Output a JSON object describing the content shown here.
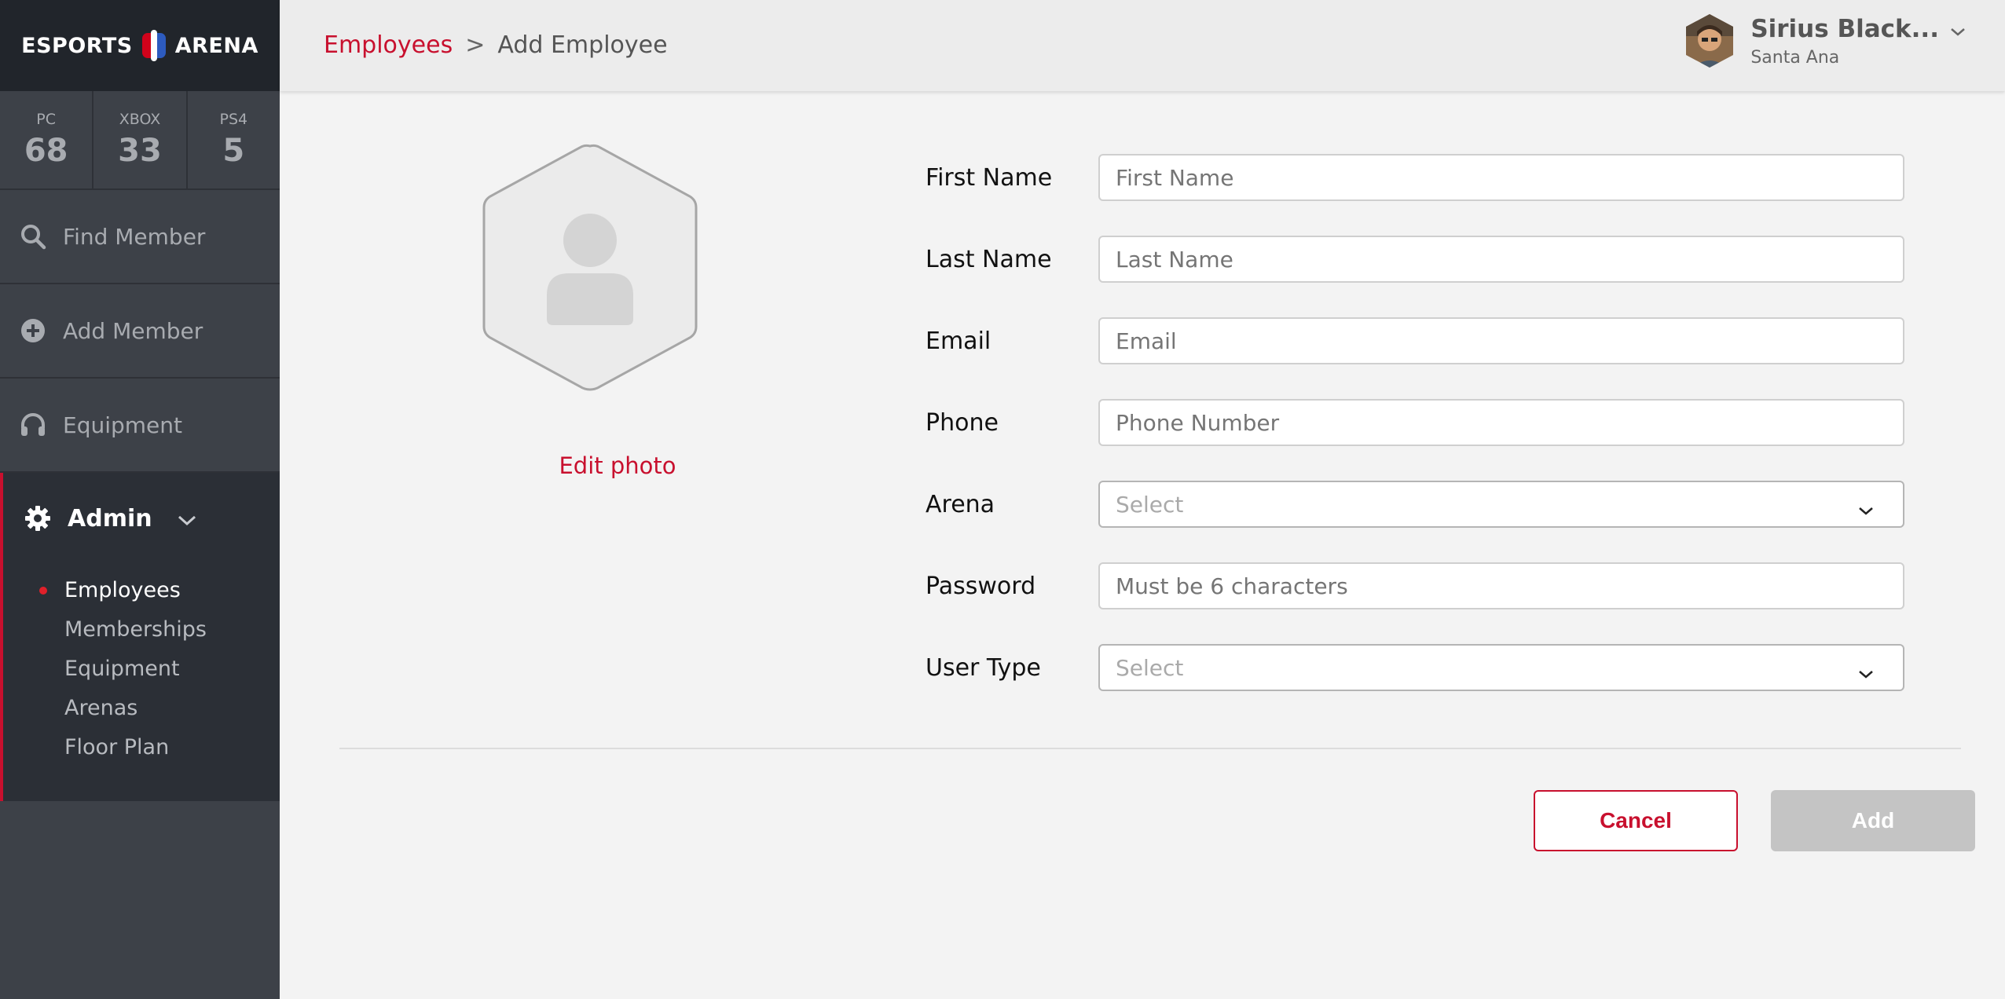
{
  "brand": {
    "left": "ESPORTS",
    "right": "ARENA"
  },
  "stats": [
    {
      "label": "PC",
      "value": "68"
    },
    {
      "label": "XBOX",
      "value": "33"
    },
    {
      "label": "PS4",
      "value": "5"
    }
  ],
  "nav": {
    "find_member": "Find Member",
    "add_member": "Add Member",
    "equipment": "Equipment",
    "admin": "Admin",
    "admin_items": [
      "Employees",
      "Memberships",
      "Equipment",
      "Arenas",
      "Floor Plan"
    ]
  },
  "breadcrumb": {
    "parent": "Employees",
    "separator": ">",
    "current": "Add Employee"
  },
  "user": {
    "name": "Sirius Black...",
    "location": "Santa Ana"
  },
  "photo": {
    "edit_label": "Edit photo"
  },
  "form": {
    "first_name": {
      "label": "First Name",
      "placeholder": "First Name"
    },
    "last_name": {
      "label": "Last Name",
      "placeholder": "Last Name"
    },
    "email": {
      "label": "Email",
      "placeholder": "Email"
    },
    "phone": {
      "label": "Phone",
      "placeholder": "Phone Number"
    },
    "arena": {
      "label": "Arena",
      "value": "Select"
    },
    "password": {
      "label": "Password",
      "placeholder": "Must be 6 characters"
    },
    "user_type": {
      "label": "User Type",
      "value": "Select"
    }
  },
  "buttons": {
    "cancel": "Cancel",
    "add": "Add"
  },
  "colors": {
    "accent": "#c8102e",
    "sidebar": "#3d4148",
    "sidebar_dark": "#21252b",
    "disabled_button": "#c4c4c4"
  }
}
